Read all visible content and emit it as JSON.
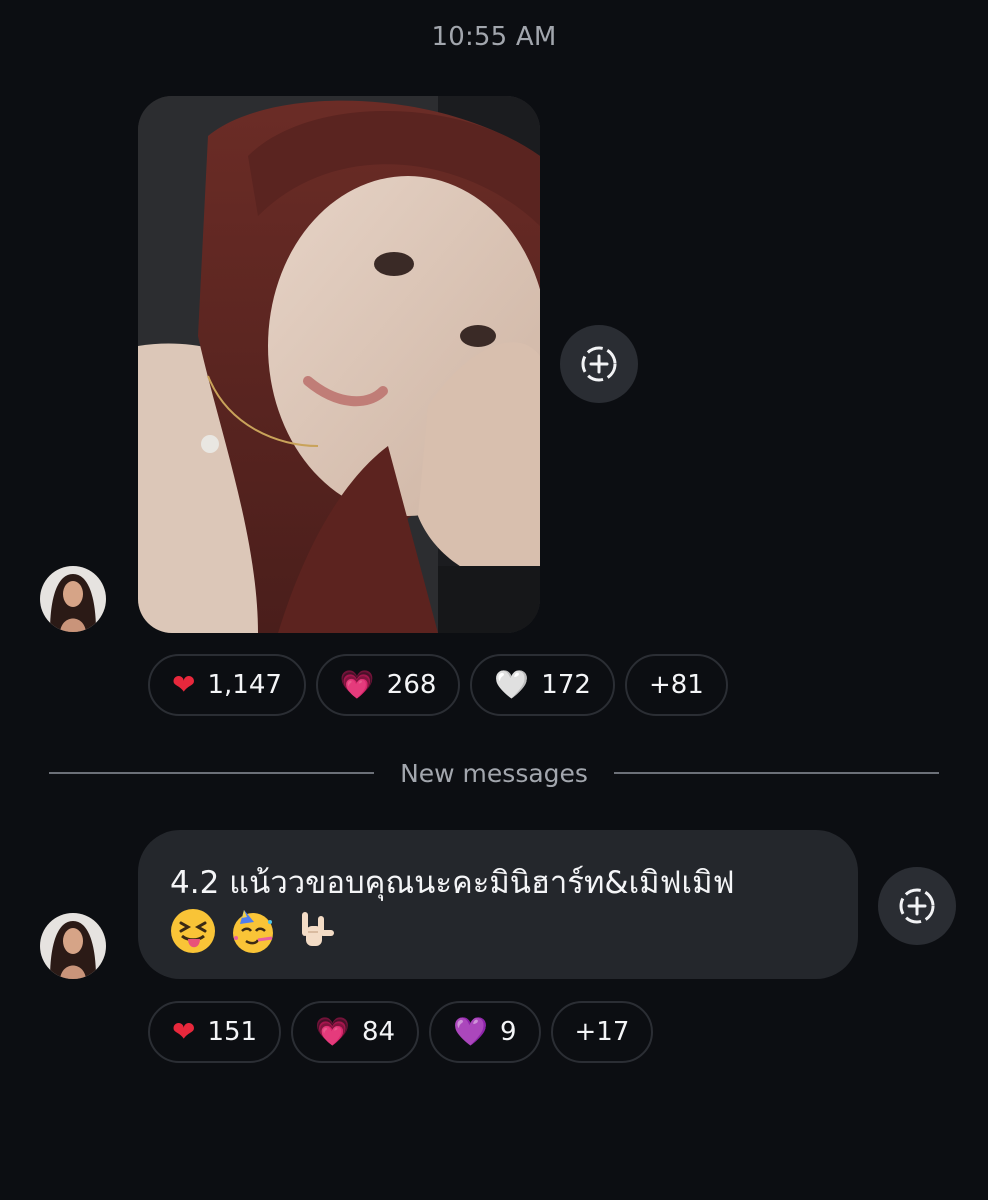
{
  "header": {
    "timestamp": "10:55 AM"
  },
  "message_1": {
    "type": "photo",
    "reactions": [
      {
        "emoji": "❤",
        "icon": "red-heart-icon",
        "count": "1,147"
      },
      {
        "emoji": "💗",
        "icon": "pink-heart-icon",
        "count": "268"
      },
      {
        "emoji": "🤍",
        "icon": "white-heart-icon",
        "count": "172"
      },
      {
        "emoji": "",
        "icon": "",
        "count": "+81"
      }
    ]
  },
  "divider": {
    "label": "New messages"
  },
  "message_2": {
    "text": "4.2 แน้ววขอบคุณนะคะมินิฮาร์ท&เมิฟเมิฟ",
    "emojis": [
      "squinting-tongue-face-icon",
      "partying-face-icon",
      "love-you-gesture-icon"
    ],
    "reactions": [
      {
        "emoji": "❤",
        "icon": "red-heart-icon",
        "count": "151"
      },
      {
        "emoji": "💗",
        "icon": "pink-heart-icon",
        "count": "84"
      },
      {
        "emoji": "💜",
        "icon": "purple-heart-icon",
        "count": "9"
      },
      {
        "emoji": "",
        "icon": "",
        "count": "+17"
      }
    ]
  },
  "colors": {
    "background": "#0c0e12",
    "bubble": "#24272c",
    "pill_border": "#2b2e34",
    "muted_text": "#a2a6ad"
  }
}
